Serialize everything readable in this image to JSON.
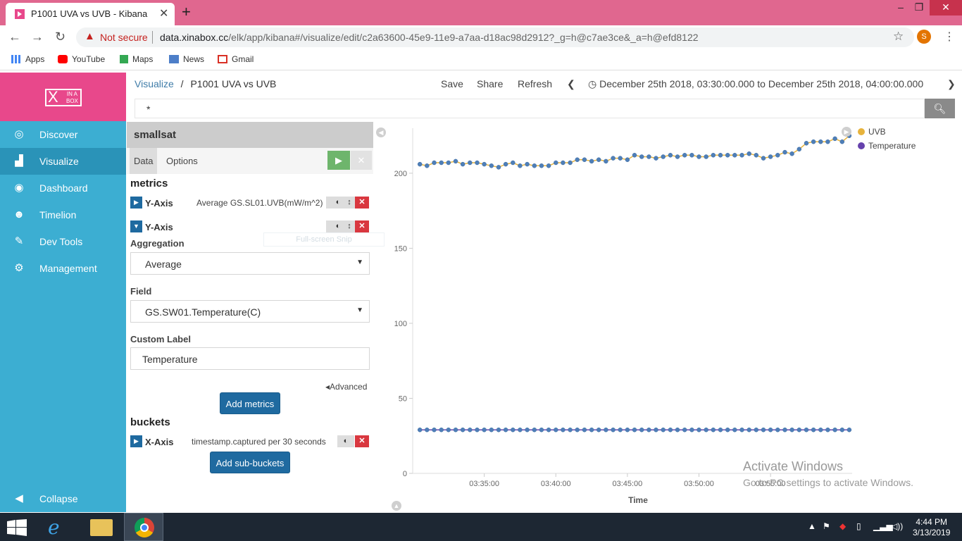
{
  "browser": {
    "tab_title": "P1001 UVA vs UVB - Kibana",
    "new_tab_glyph": "+",
    "not_secure": "Not secure",
    "url_host": "data.xinabox.cc",
    "url_path": "/elk/app/kibana#/visualize/edit/c2a63600-45e9-11e9-a7aa-d18ac98d2912?_g=h@c7ae3ce&_a=h@efd8122",
    "profile_initial": "S",
    "bookmarks": [
      "Apps",
      "YouTube",
      "Maps",
      "News",
      "Gmail"
    ]
  },
  "logo": {
    "text_x": "X",
    "text_in_a": "IN A",
    "text_box": "BOX"
  },
  "nav": {
    "items": [
      {
        "label": "Discover",
        "icon": "compass-icon"
      },
      {
        "label": "Visualize",
        "icon": "bar-chart-icon"
      },
      {
        "label": "Dashboard",
        "icon": "dashboard-icon"
      },
      {
        "label": "Timelion",
        "icon": "timelion-icon"
      },
      {
        "label": "Dev Tools",
        "icon": "wrench-icon"
      },
      {
        "label": "Management",
        "icon": "gear-icon"
      }
    ],
    "collapse": "Collapse"
  },
  "header": {
    "crumb_root": "Visualize",
    "crumb_sep": "/",
    "crumb_current": "P1001 UVA vs UVB",
    "save": "Save",
    "share": "Share",
    "refresh": "Refresh",
    "time_range": "December 25th 2018, 03:30:00.000 to December 25th 2018, 04:00:00.000",
    "query": "*"
  },
  "editor": {
    "index": "smallsat",
    "tab_data": "Data",
    "tab_options": "Options",
    "metrics_title": "metrics",
    "metric1": {
      "name": "Y-Axis",
      "desc": "Average GS.SL01.UVB(mW/m^2)"
    },
    "metric2": {
      "name": "Y-Axis"
    },
    "aggregation_label": "Aggregation",
    "aggregation_value": "Average",
    "field_label": "Field",
    "field_value": "GS.SW01.Temperature(C)",
    "custom_label_label": "Custom Label",
    "custom_label_value": "Temperature",
    "advanced": "Advanced",
    "add_metrics": "Add metrics",
    "buckets_title": "buckets",
    "bucket1": {
      "name": "X-Axis",
      "desc": "timestamp.captured per 30 seconds"
    },
    "add_sub_buckets": "Add sub-buckets",
    "snip_overlay": "Full-screen Snip"
  },
  "chart_data": {
    "type": "line",
    "xlabel": "Time",
    "x_ticks": [
      "03:35:00",
      "03:40:00",
      "03:45:00",
      "03:50:00",
      "03:55:00"
    ],
    "y_ticks": [
      0,
      50,
      100,
      150,
      200
    ],
    "ylim": [
      0,
      230
    ],
    "x_start_minute": 30.5,
    "x_step_minutes": 0.5,
    "legend_position": "top-right",
    "series": [
      {
        "name": "UVB",
        "color": "#e7b33c",
        "values": [
          206,
          205,
          207,
          207,
          207,
          208,
          206,
          207,
          207,
          206,
          205,
          204,
          206,
          207,
          205,
          206,
          205,
          205,
          205,
          207,
          207,
          207,
          209,
          209,
          208,
          209,
          208,
          210,
          210,
          209,
          212,
          211,
          211,
          210,
          211,
          212,
          211,
          212,
          212,
          211,
          211,
          212,
          212,
          212,
          212,
          212,
          213,
          212,
          210,
          211,
          212,
          214,
          213,
          216,
          220,
          221,
          221,
          221,
          223,
          221,
          225
        ]
      },
      {
        "name": "Temperature",
        "color": "#6642ad",
        "values": [
          29,
          29,
          29,
          29,
          29,
          29,
          29,
          29,
          29,
          29,
          29,
          29,
          29,
          29,
          29,
          29,
          29,
          29,
          29,
          29,
          29,
          29,
          29,
          29,
          29,
          29,
          29,
          29,
          29,
          29,
          29,
          29,
          29,
          29,
          29,
          29,
          29,
          29,
          29,
          29,
          29,
          29,
          29,
          29,
          29,
          29,
          29,
          29,
          29,
          29,
          29,
          29,
          29,
          29,
          29,
          29,
          29,
          29,
          29,
          29,
          29
        ]
      }
    ]
  },
  "watermark": {
    "line1": "Activate Windows",
    "line2": "Go to PC settings to activate Windows."
  },
  "taskbar": {
    "time": "4:44 PM",
    "date": "3/13/2019"
  }
}
